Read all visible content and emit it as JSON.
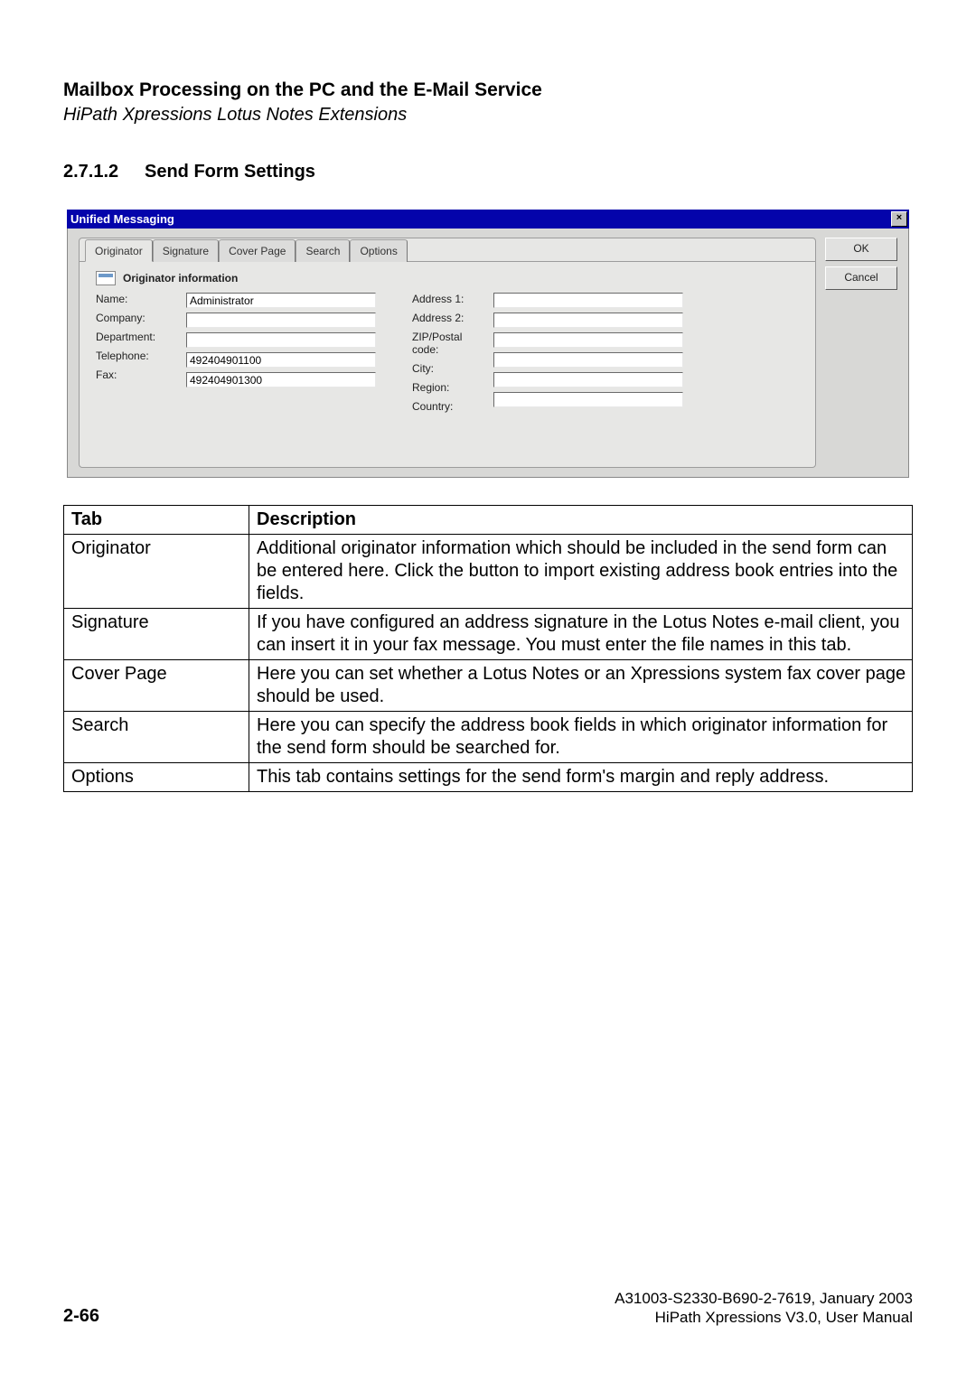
{
  "header": {
    "title": "Mailbox Processing on the PC and the E-Mail Service",
    "subtitle": "HiPath Xpressions Lotus Notes Extensions"
  },
  "section": {
    "number": "2.7.1.2",
    "title": "Send Form Settings"
  },
  "dialog": {
    "title": "Unified Messaging",
    "close_glyph": "×",
    "buttons": {
      "ok": "OK",
      "cancel": "Cancel"
    },
    "tabs": [
      "Originator",
      "Signature",
      "Cover Page",
      "Search",
      "Options"
    ],
    "section_label": "Originator information",
    "fields_left": {
      "name": {
        "label": "Name:",
        "value": "Administrator"
      },
      "company": {
        "label": "Company:",
        "value": ""
      },
      "department": {
        "label": "Department:",
        "value": ""
      },
      "telephone": {
        "label": "Telephone:",
        "value": "492404901100"
      },
      "fax": {
        "label": "Fax:",
        "value": "492404901300"
      }
    },
    "fields_right": {
      "address1": {
        "label": "Address 1:",
        "value": ""
      },
      "address2": {
        "label": "Address 2:",
        "value": ""
      },
      "zip": {
        "label": "ZIP/Postal code:",
        "value": ""
      },
      "city": {
        "label": "City:",
        "value": ""
      },
      "region": {
        "label": "Region:",
        "value": ""
      },
      "country": {
        "label": "Country:",
        "value": ""
      }
    }
  },
  "table": {
    "headers": {
      "tab": "Tab",
      "desc": "Description"
    },
    "rows": [
      {
        "tab": "Originator",
        "desc": "Additional originator information which should be included in the send form can be entered here. Click the button to import existing address book entries into the fields."
      },
      {
        "tab": "Signature",
        "desc": "If you have configured an address signature in the Lotus Notes e-mail client, you can insert it in your fax message. You must enter the file names in this tab."
      },
      {
        "tab": "Cover Page",
        "desc": "Here you can set whether a Lotus Notes or an Xpressions system fax cover page should be used."
      },
      {
        "tab": "Search",
        "desc": "Here you can specify the address book fields in which originator information for the send form should be searched for."
      },
      {
        "tab": "Options",
        "desc": "This tab contains settings for the send form's margin and reply address."
      }
    ]
  },
  "footer": {
    "page": "2-66",
    "doc_id": "A31003-S2330-B690-2-7619, January 2003",
    "manual": "HiPath Xpressions V3.0, User Manual"
  }
}
